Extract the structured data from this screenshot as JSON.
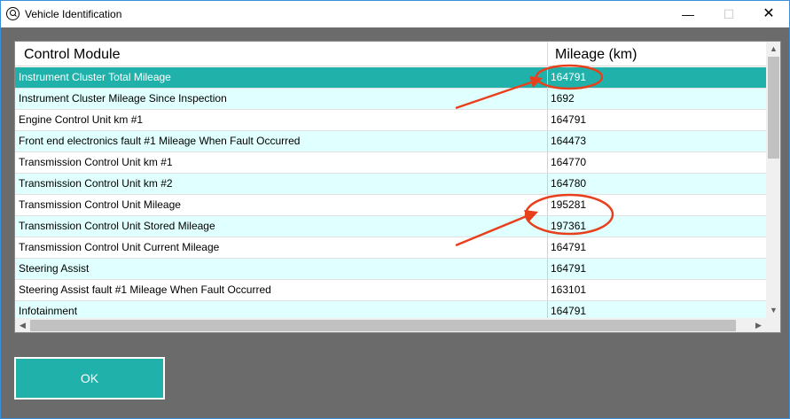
{
  "window": {
    "title": "Vehicle Identification",
    "icons": {
      "app": "magnifier-icon",
      "minimize": "minimize-icon",
      "maximize": "maximize-icon",
      "close": "close-icon"
    },
    "minimize_glyph": "—",
    "maximize_glyph": "☐",
    "close_glyph": "✕"
  },
  "grid": {
    "columns": [
      "Control Module",
      "Mileage (km)"
    ],
    "rows": [
      {
        "module": "Instrument Cluster Total Mileage",
        "mileage": "164791"
      },
      {
        "module": "Instrument Cluster Mileage Since Inspection",
        "mileage": "1692"
      },
      {
        "module": "Engine Control Unit km #1",
        "mileage": "164791"
      },
      {
        "module": "Front end electronics fault #1 Mileage When Fault Occurred",
        "mileage": "164473"
      },
      {
        "module": "Transmission Control Unit km #1",
        "mileage": "164770"
      },
      {
        "module": "Transmission Control Unit km #2",
        "mileage": "164780"
      },
      {
        "module": "Transmission Control Unit Mileage",
        "mileage": "195281"
      },
      {
        "module": "Transmission Control Unit Stored Mileage",
        "mileage": "197361"
      },
      {
        "module": "Transmission Control Unit Current Mileage",
        "mileage": "164791"
      },
      {
        "module": "Steering Assist",
        "mileage": "164791"
      },
      {
        "module": "Steering Assist fault #1 Mileage When Fault Occurred",
        "mileage": "163101"
      },
      {
        "module": "Infotainment",
        "mileage": "164791"
      }
    ],
    "selected_row": 0,
    "scroll_glyphs": {
      "up": "▲",
      "down": "▼",
      "left": "◀",
      "right": "▶"
    }
  },
  "colors": {
    "selection": "#20b2aa",
    "alt_row": "#e0ffff",
    "annotation": "#e8401c",
    "background": "#6b6b6b"
  },
  "ok_button": {
    "label": "OK"
  }
}
